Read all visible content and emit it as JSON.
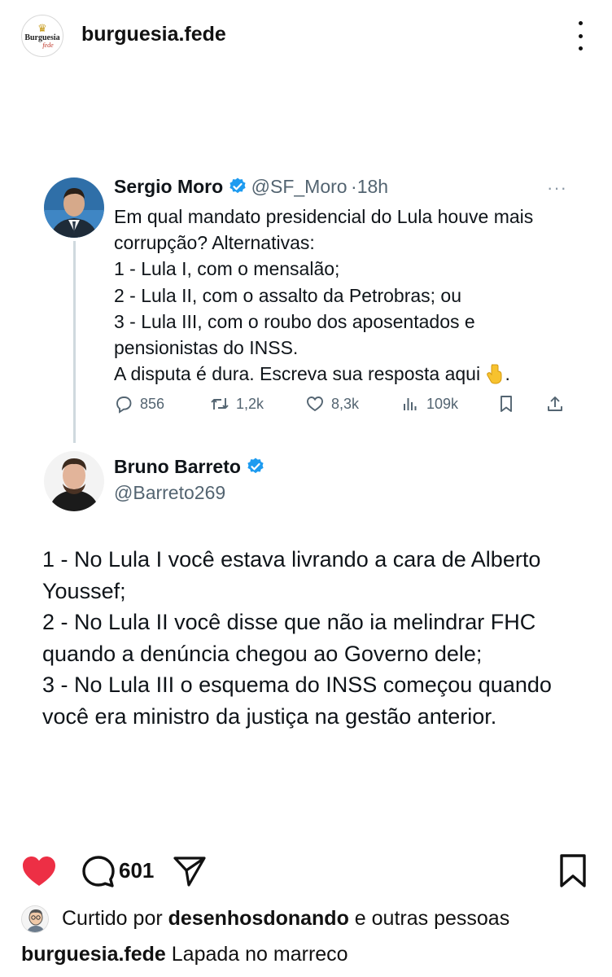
{
  "post": {
    "username": "burguesia.fede",
    "avatar_label": "Burguesia",
    "avatar_sublabel": "fede",
    "more_icon": "more-vertical-icon"
  },
  "tweet1": {
    "name": "Sergio Moro",
    "handle": "@SF_Moro",
    "separator": "·",
    "time": "18h",
    "more": "···",
    "lines": [
      "Em qual mandato presidencial do Lula houve mais",
      "corrupção? Alternativas:",
      "1 - Lula I, com o mensalão;",
      "2 - Lula II, com o assalto da Petrobras; ou",
      "3 - Lula III, com o roubo dos aposentados e",
      "pensionistas do INSS.",
      "A disputa é dura. Escreva sua resposta aqui"
    ],
    "last_line_end": ".",
    "replies": "856",
    "retweets": "1,2k",
    "likes": "8,3k",
    "views": "109k"
  },
  "tweet2": {
    "name": "Bruno Barreto",
    "handle": "@Barreto269",
    "lines": [
      "1 - No Lula I você estava livrando a cara de Alberto",
      "Youssef;",
      "2 - No Lula II você disse que não ia melindrar FHC",
      "quando a denúncia chegou ao Governo dele;",
      "3 - No Lula III o esquema do INSS começou quando",
      "você era ministro da justiça na gestão anterior."
    ]
  },
  "footer": {
    "comment_count": "601",
    "liked_prefix": "Curtido por ",
    "liked_user": "desenhosdonando",
    "liked_suffix": " e outras pessoas",
    "caption_user": "burguesia.fede",
    "caption_text": " Lapada no marreco"
  },
  "colors": {
    "verified": "#1d9bf0",
    "heart": "#ed2f45",
    "muted": "#536471",
    "thread": "#cfd9de"
  }
}
